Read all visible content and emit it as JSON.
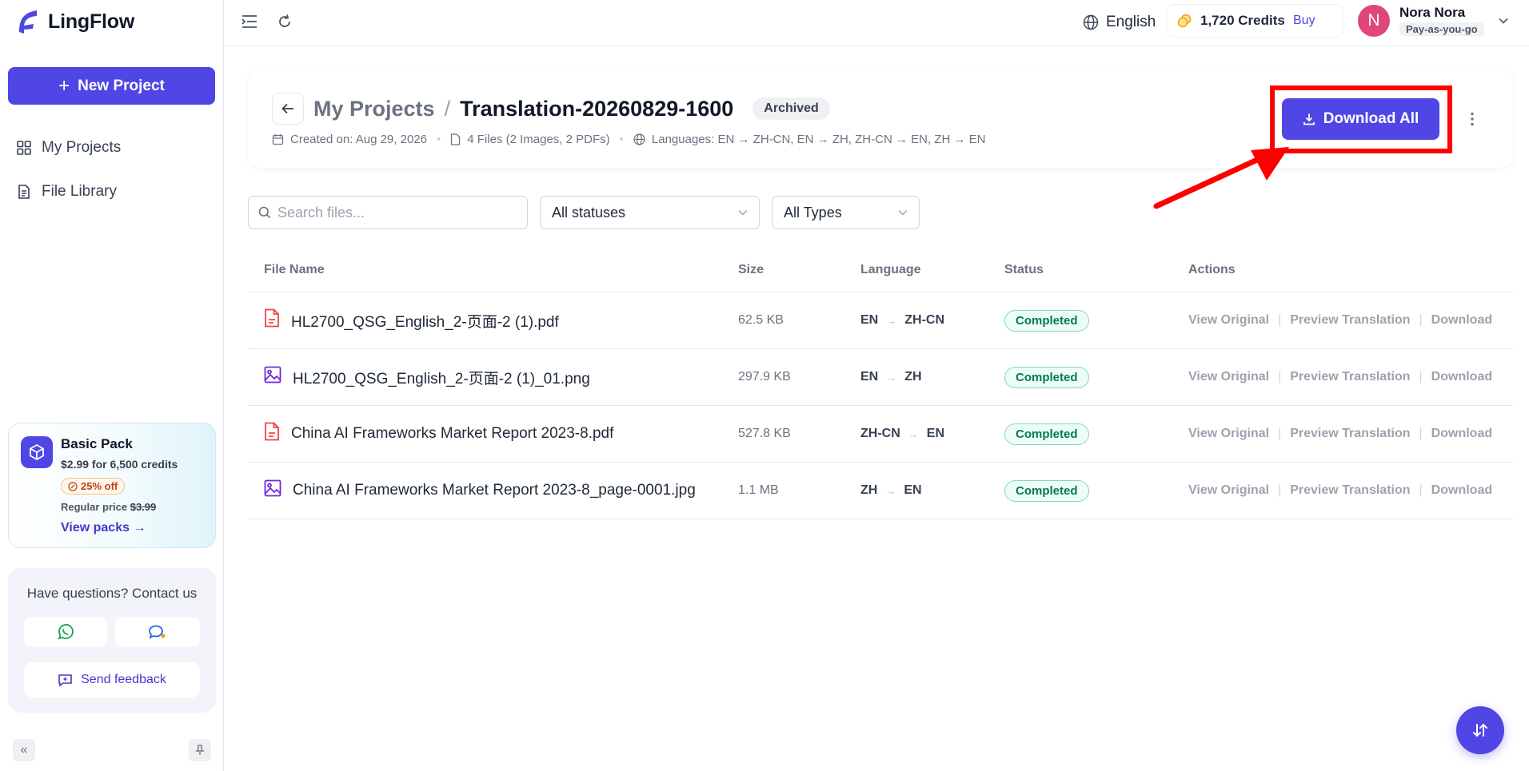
{
  "brand": {
    "name": "LingFlow"
  },
  "sidebar": {
    "new_project_label": "New Project",
    "nav": [
      {
        "label": "My Projects",
        "icon": "grid-icon"
      },
      {
        "label": "File Library",
        "icon": "document-icon"
      }
    ],
    "promo": {
      "title": "Basic Pack",
      "price": "$2.99 for 6,500 credits",
      "badge": "25% off",
      "regular_label": "Regular price",
      "regular_price": "$3.99",
      "link": "View packs"
    },
    "contact": {
      "title": "Have questions? Contact us",
      "feedback_label": "Send feedback"
    }
  },
  "topbar": {
    "language": "English",
    "credits": "1,720 Credits",
    "buy_label": "Buy",
    "user": {
      "initial": "N",
      "name": "Nora Nora",
      "plan": "Pay-as-you-go"
    }
  },
  "project": {
    "breadcrumb_parent": "My Projects",
    "breadcrumb_sep": "/",
    "name": "Translation-20260829-1600",
    "status": "Archived",
    "created": "Created on: Aug 29, 2026",
    "files": "4 Files (2 Images, 2 PDFs)",
    "languages": "Languages: EN → ZH-CN, EN → ZH, ZH-CN → EN, ZH → EN",
    "download_all_label": "Download All"
  },
  "filters": {
    "search_placeholder": "Search files...",
    "status_value": "All statuses",
    "type_value": "All Types"
  },
  "table": {
    "headers": {
      "name": "File Name",
      "size": "Size",
      "language": "Language",
      "status": "Status",
      "actions": "Actions"
    },
    "action_labels": {
      "view": "View Original",
      "preview": "Preview Translation",
      "download": "Download"
    },
    "rows": [
      {
        "name": "HL2700_QSG_English_2-页面-2 (1).pdf",
        "type": "pdf",
        "size": "62.5 KB",
        "src": "EN",
        "tgt": "ZH-CN",
        "status": "Completed"
      },
      {
        "name": "HL2700_QSG_English_2-页面-2 (1)_01.png",
        "type": "image",
        "size": "297.9 KB",
        "src": "EN",
        "tgt": "ZH",
        "status": "Completed"
      },
      {
        "name": "China AI Frameworks Market Report 2023-8.pdf",
        "type": "pdf",
        "size": "527.8 KB",
        "src": "ZH-CN",
        "tgt": "EN",
        "status": "Completed"
      },
      {
        "name": "China AI Frameworks Market Report 2023-8_page-0001.jpg",
        "type": "image",
        "size": "1.1 MB",
        "src": "ZH",
        "tgt": "EN",
        "status": "Completed"
      }
    ]
  },
  "colors": {
    "accent": "#4f46e5",
    "success": "#047857",
    "pdf": "#ef4444",
    "image": "#6d28d9",
    "highlight": "#ff0000"
  }
}
